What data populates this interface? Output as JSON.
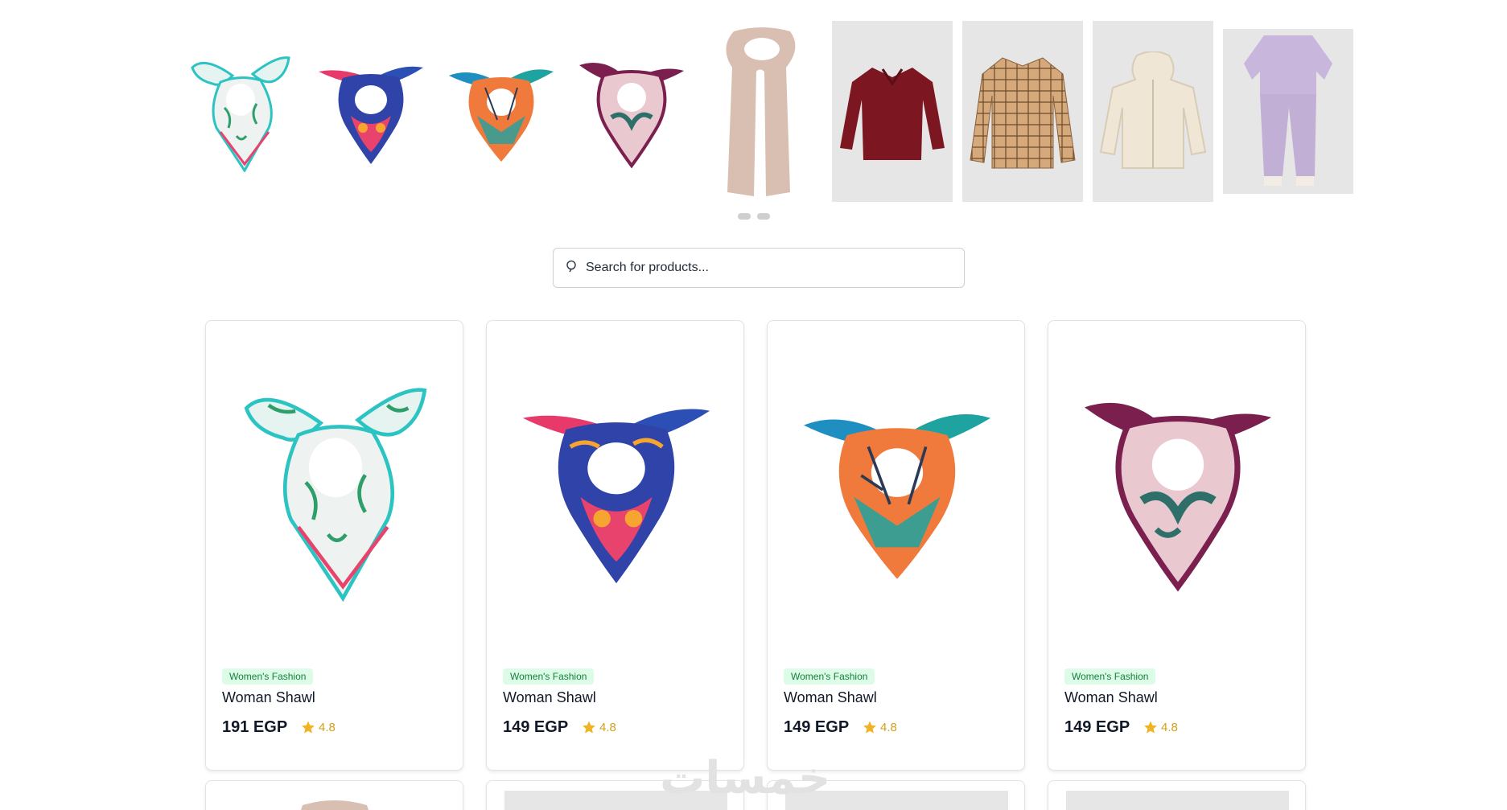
{
  "slider": {
    "images": [
      {
        "name": "floral-scarf-thumb-1"
      },
      {
        "name": "blue-pink-scarf-thumb-2"
      },
      {
        "name": "orange-teal-scarf-thumb-3"
      },
      {
        "name": "burgundy-scarf-thumb-4"
      },
      {
        "name": "beige-long-scarf-thumb-5"
      },
      {
        "name": "burgundy-shirt-thumb-6"
      },
      {
        "name": "plaid-shirt-thumb-7"
      },
      {
        "name": "cream-hoodie-thumb-8"
      },
      {
        "name": "lilac-set-thumb-9"
      }
    ],
    "dots": 2
  },
  "search": {
    "placeholder": "Search for products...",
    "icon": "search-icon"
  },
  "products": [
    {
      "category": "Women's Fashion",
      "name": "Woman Shawl",
      "price": "191 EGP",
      "rating": "4.8"
    },
    {
      "category": "Women's Fashion",
      "name": "Woman Shawl",
      "price": "149 EGP",
      "rating": "4.8"
    },
    {
      "category": "Women's Fashion",
      "name": "Woman Shawl",
      "price": "149 EGP",
      "rating": "4.8"
    },
    {
      "category": "Women's Fashion",
      "name": "Woman Shawl",
      "price": "149 EGP",
      "rating": "4.8"
    }
  ],
  "watermark": "خمسات",
  "colors": {
    "badge_bg": "#dcfce7",
    "badge_text": "#15803d",
    "star": "#f0b323",
    "card_border": "#e3e3e3"
  }
}
